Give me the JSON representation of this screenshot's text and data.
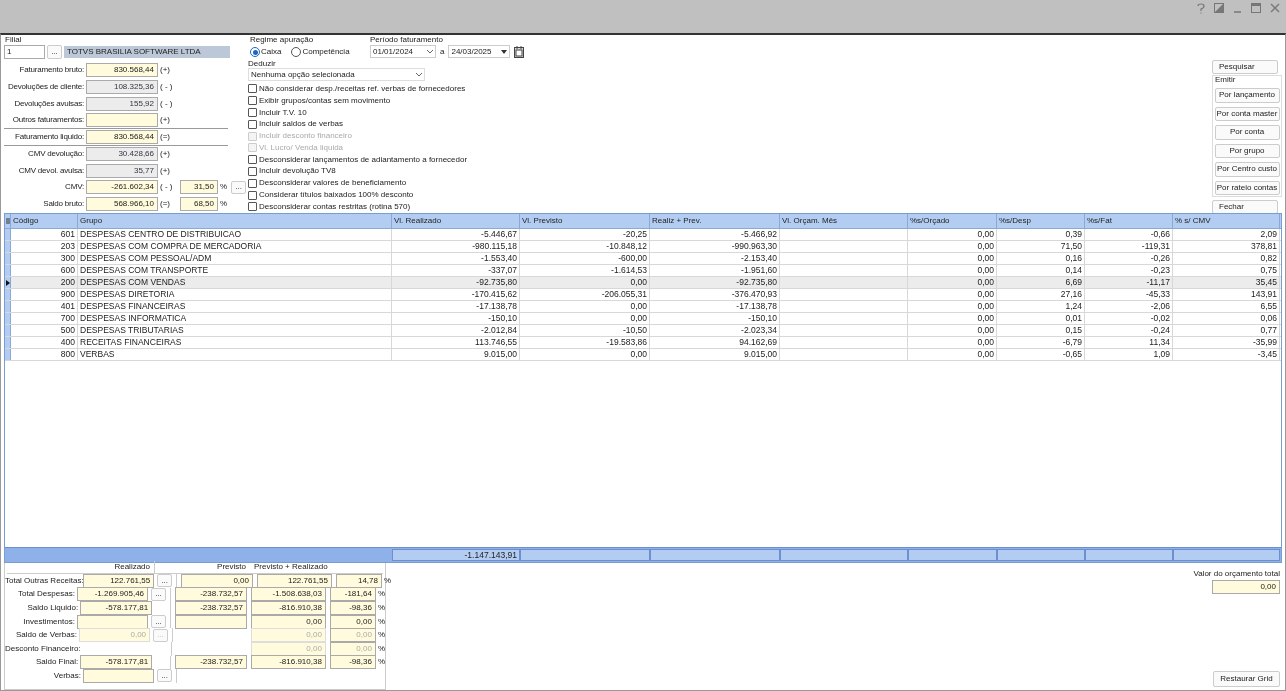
{
  "filial": {
    "label": "Filial",
    "code": "1",
    "more": "...",
    "name": "TOTVS BRASILIA SOFTWARE LTDA"
  },
  "summary_fields": [
    {
      "label": "Faturamento bruto:",
      "value": "830.568,44",
      "sign": "(+)",
      "readonly": false,
      "divider_below": false
    },
    {
      "label": "Devoluções de cliente:",
      "value": "108.325,36",
      "sign": "( - )",
      "readonly": true,
      "divider_below": false
    },
    {
      "label": "Devoluções avulsas:",
      "value": "155,92",
      "sign": "( - )",
      "readonly": true,
      "divider_below": false
    },
    {
      "label": "Outros faturamentos:",
      "sign": "(+)",
      "readonly": false,
      "divider_below": true
    },
    {
      "label": "Faturamento liquido:",
      "value": "830.568,44",
      "sign": "(=)",
      "readonly": false,
      "divider_below": true
    },
    {
      "label": "CMV devolução:",
      "value": "30.428,66",
      "sign": "(+)",
      "readonly": true,
      "divider_below": false
    },
    {
      "label": "CMV devol. avulsa:",
      "value": "35,77",
      "sign": "(+)",
      "readonly": true,
      "divider_below": false
    },
    {
      "label": "CMV:",
      "value": "-261.602,34",
      "sign": "( - )",
      "readonly": false,
      "divider_below": false,
      "percent": "31,50",
      "unit": "%",
      "more": "..."
    },
    {
      "label": "Saldo bruto:",
      "value": "568.966,10",
      "sign": "(=)",
      "readonly": false,
      "divider_below": false,
      "percent": "68,50",
      "unit": "%"
    }
  ],
  "regime": {
    "label": "Regime apuração",
    "options": [
      {
        "label": "Caixa",
        "selected": true
      },
      {
        "label": "Competência",
        "selected": false
      }
    ]
  },
  "periodo": {
    "label": "Período faturamento",
    "from": "01/01/2024",
    "separator": "a",
    "to": "24/03/2025"
  },
  "deduzir": {
    "label": "Deduzir",
    "value": "Nenhuma opção selecionada"
  },
  "options": [
    {
      "label": "Não considerar desp./receitas ref. verbas de fornecedores",
      "checked": false,
      "disabled": false
    },
    {
      "label": "Exibir grupos/contas sem movimento",
      "checked": false,
      "disabled": false
    },
    {
      "label": "Incluir T.V. 10",
      "checked": false,
      "disabled": false
    },
    {
      "label": "Incluir saldos de verbas",
      "checked": false,
      "disabled": false
    },
    {
      "label": "Incluir desconto financeiro",
      "checked": false,
      "disabled": true
    },
    {
      "label": "Vl. Lucro/ Venda liquida",
      "checked": false,
      "disabled": true
    },
    {
      "label": "Desconsiderar lançamentos de adiantamento a fornecedor",
      "checked": false,
      "disabled": false
    },
    {
      "label": "Incluir devolução TV8",
      "checked": false,
      "disabled": false
    },
    {
      "label": "Desconsiderar valores de beneficiamento",
      "checked": false,
      "disabled": false
    },
    {
      "label": "Considerar títulos baixados 100% desconto",
      "checked": false,
      "disabled": false
    },
    {
      "label": "Desconsiderar contas restritas (rotina 570)",
      "checked": false,
      "disabled": false
    }
  ],
  "actions": {
    "search": "Pesquisar",
    "emit_label": "Emitir",
    "emit": [
      "Por lançamento",
      "Por conta master",
      "Por conta",
      "Por grupo",
      "Por Centro custo",
      "Por rateio contas"
    ],
    "close": "Fechar"
  },
  "grid": {
    "columns": [
      "Código",
      "Grupo",
      "Vl. Realizado",
      "Vl. Previsto",
      "Realiz + Prev.",
      "Vl. Orçam. Mês",
      "%s/Orçado",
      "%s/Desp",
      "%s/Fat",
      "% s/ CMV"
    ],
    "rows": [
      {
        "selected": false,
        "cells": [
          "601",
          "DESPESAS CENTRO DE DISTRIBUICAO",
          "-5.446,67",
          "-20,25",
          "-5.466,92",
          "",
          "0,00",
          "0,39",
          "-0,66",
          "2,09"
        ]
      },
      {
        "selected": false,
        "cells": [
          "203",
          "DESPESAS COM COMPRA DE MERCADORIA",
          "-980.115,18",
          "-10.848,12",
          "-990.963,30",
          "",
          "0,00",
          "71,50",
          "-119,31",
          "378,81"
        ]
      },
      {
        "selected": false,
        "cells": [
          "300",
          "DESPESAS COM PESSOAL/ADM",
          "-1.553,40",
          "-600,00",
          "-2.153,40",
          "",
          "0,00",
          "0,16",
          "-0,26",
          "0,82"
        ]
      },
      {
        "selected": false,
        "cells": [
          "600",
          "DESPESAS COM TRANSPORTE",
          "-337,07",
          "-1.614,53",
          "-1.951,60",
          "",
          "0,00",
          "0,14",
          "-0,23",
          "0,75"
        ]
      },
      {
        "selected": true,
        "cells": [
          "200",
          "DESPESAS COM VENDAS",
          "-92.735,80",
          "0,00",
          "-92.735,80",
          "",
          "0,00",
          "6,69",
          "-11,17",
          "35,45"
        ]
      },
      {
        "selected": false,
        "cells": [
          "900",
          "DESPESAS DIRETORIA",
          "-170.415,62",
          "-206.055,31",
          "-376.470,93",
          "",
          "0,00",
          "27,16",
          "-45,33",
          "143,91"
        ]
      },
      {
        "selected": false,
        "cells": [
          "401",
          "DESPESAS FINANCEIRAS",
          "-17.138,78",
          "0,00",
          "-17.138,78",
          "",
          "0,00",
          "1,24",
          "-2,06",
          "6,55"
        ]
      },
      {
        "selected": false,
        "cells": [
          "700",
          "DESPESAS INFORMATICA",
          "-150,10",
          "0,00",
          "-150,10",
          "",
          "0,00",
          "0,01",
          "-0,02",
          "0,06"
        ]
      },
      {
        "selected": false,
        "cells": [
          "500",
          "DESPESAS TRIBUTARIAS",
          "-2.012,84",
          "-10,50",
          "-2.023,34",
          "",
          "0,00",
          "0,15",
          "-0,24",
          "0,77"
        ]
      },
      {
        "selected": false,
        "cells": [
          "400",
          "RECEITAS FINANCEIRAS",
          "113.746,55",
          "-19.583,86",
          "94.162,69",
          "",
          "0,00",
          "-6,79",
          "11,34",
          "-35,99"
        ]
      },
      {
        "selected": false,
        "cells": [
          "800",
          "VERBAS",
          "9.015,00",
          "0,00",
          "9.015,00",
          "",
          "0,00",
          "-0,65",
          "1,09",
          "-3,45"
        ]
      }
    ],
    "total_realizado": "-1.147.143,91"
  },
  "results": {
    "headers": [
      "Realizado",
      "Previsto",
      "Previsto + Realizado"
    ],
    "rows": [
      {
        "label": "Total Outras Receitas:",
        "realizado": "122.761,55",
        "more": "...",
        "previsto": "0,00",
        "total": "122.761,55",
        "percent": "14,78",
        "unit": "%",
        "disabled": false
      },
      {
        "label": "Total Despesas:",
        "realizado": "-1.269.905,46",
        "more": "...",
        "previsto": "-238.732,57",
        "total": "-1.508.638,03",
        "percent": "-181,64",
        "unit": "%",
        "disabled": false
      },
      {
        "label": "Saldo Liquido:",
        "realizado": "-578.177,81",
        "previsto": "-238.732,57",
        "total": "-816.910,38",
        "percent": "-98,36",
        "unit": "%",
        "disabled": false
      },
      {
        "label": "Investimentos:",
        "realizado": "",
        "more": "...",
        "previsto": "",
        "total": "0,00",
        "percent": "0,00",
        "unit": "%",
        "disabled": false
      },
      {
        "label": "Saldo de Verbas:",
        "realizado": "0,00",
        "more": "...",
        "total": "0,00",
        "percent": "0,00",
        "unit": "%",
        "disabled": true
      },
      {
        "label": "Desconto Financeiro:",
        "total": "0,00",
        "percent": "0,00",
        "unit": "%",
        "disabled": true
      },
      {
        "label": "Saldo Final:",
        "realizado": "-578.177,81",
        "previsto": "-238.732,57",
        "total": "-816.910,38",
        "percent": "-98,36",
        "unit": "%",
        "disabled": false
      },
      {
        "label": "Verbas:",
        "realizado": "",
        "more": "...",
        "disabled": false
      }
    ]
  },
  "budget": {
    "label": "Valor do orçamento total",
    "value": "0,00"
  },
  "restore_button": "Restaurar Grid"
}
